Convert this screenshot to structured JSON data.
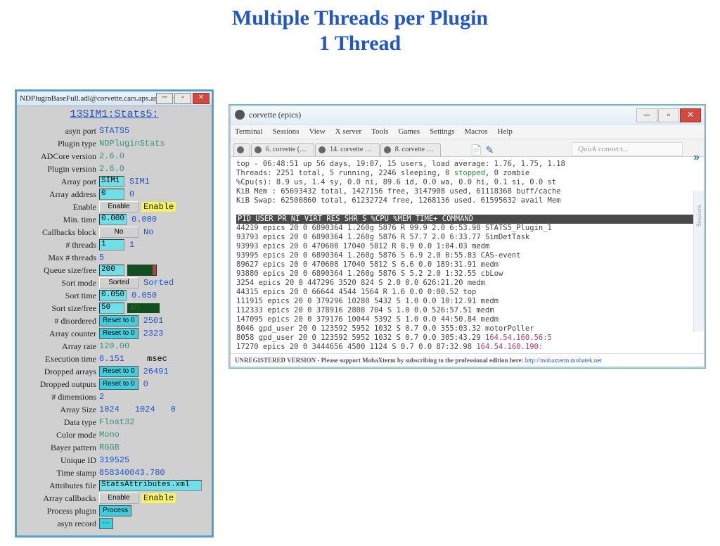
{
  "heading": "Multiple Threads per Plugin\n1 Thread",
  "medm": {
    "title": "NDPluginBaseFull.adl@corvette.cars.aps.anl.gov",
    "head": "13SIM1:Stats5:",
    "rows": [
      {
        "k": "asyn port",
        "v": "STATS5",
        "c": "blue"
      },
      {
        "k": "Plugin type",
        "v": "NDPluginStats",
        "c": "teal"
      },
      {
        "k": "ADCore version",
        "v": "2.6.0",
        "c": "teal"
      },
      {
        "k": "Plugin version",
        "v": "2.6.0",
        "c": "teal"
      },
      {
        "k": "Array port",
        "v": "SIM1",
        "ctl": "cyanfield",
        "suf": "SIM1",
        "sc": "blue"
      },
      {
        "k": "Array address",
        "v": "0",
        "ctl": "cyanfield",
        "suf": "0",
        "sc": "blue"
      },
      {
        "k": "Enable",
        "v": "Enable",
        "ctl": "drop",
        "suf": "Enable",
        "yellow": true
      },
      {
        "k": "Min. time",
        "v": "0.000",
        "ctl": "cyanfield",
        "suf": "0.000",
        "sc": "blue"
      },
      {
        "k": "Callbacks block",
        "v": "No",
        "ctl": "drop",
        "suf": "No",
        "sc": "blue"
      },
      {
        "k": "# threads",
        "v": "1",
        "ctl": "cyanfield",
        "suf": "1",
        "sc": "blue"
      },
      {
        "k": "Max # threads",
        "v": "5",
        "c": "blue"
      },
      {
        "k": "Queue size/free",
        "v": "200",
        "ctl": "cyanfield",
        "bar": true
      },
      {
        "k": "Sort mode",
        "v": "Sorted",
        "ctl": "drop",
        "suf": "Sorted",
        "sc": "blue"
      },
      {
        "k": "Sort time",
        "v": "0.050",
        "ctl": "cyanfield",
        "suf": "0.050",
        "sc": "blue"
      },
      {
        "k": "Sort size/free",
        "v": "50",
        "ctl": "cyanfield",
        "suf": "48",
        "sc": "grn",
        "dark": true
      },
      {
        "k": "# disordered",
        "v": "Reset to 0",
        "ctl": "cyanbtn",
        "suf": "2501",
        "sc": "blue"
      },
      {
        "k": "Array counter",
        "v": "Reset to 0",
        "ctl": "cyanbtn",
        "suf": "2323",
        "sc": "blue"
      },
      {
        "k": "Array rate",
        "v": "120.00",
        "c": "teal"
      },
      {
        "k": "Execution time",
        "v": "8.151",
        "c": "blue",
        "suf": "msec",
        "sc": ""
      },
      {
        "k": "Dropped arrays",
        "v": "Reset to 0",
        "ctl": "cyanbtn",
        "suf": "26491",
        "sc": "blue"
      },
      {
        "k": "Dropped outputs",
        "v": "Reset to 0",
        "ctl": "cyanbtn",
        "suf": "0",
        "sc": "blue"
      },
      {
        "k": "# dimensions",
        "v": "2",
        "c": "blue"
      },
      {
        "k": "Array Size",
        "v": "1024",
        "c": "blue",
        "extra": [
          "1024",
          "0"
        ]
      },
      {
        "k": "Data type",
        "v": "Float32",
        "c": "teal"
      },
      {
        "k": "Color mode",
        "v": "Mono",
        "c": "teal"
      },
      {
        "k": "Bayer pattern",
        "v": "RGGB",
        "c": "teal"
      },
      {
        "k": "Unique ID",
        "v": "319525",
        "c": "blue"
      },
      {
        "k": "Time stamp",
        "v": "858340043.780",
        "c": "blue"
      },
      {
        "k": "Attributes file",
        "v": "StatsAttributes.xml",
        "ctl": "cyanfield",
        "wide": true
      },
      {
        "k": "Array callbacks",
        "v": "Enable",
        "ctl": "drop",
        "suf": "Enable",
        "yellow": true
      },
      {
        "k": "Process plugin",
        "v": "Process",
        "ctl": "cyanbtn"
      },
      {
        "k": "asyn record",
        "v": " ⋯ ",
        "ctl": "cyanbtn"
      }
    ]
  },
  "moba": {
    "title": "corvette (epics)",
    "menu": [
      "Terminal",
      "Sessions",
      "View",
      "X server",
      "Tools",
      "Games",
      "Settings",
      "Macros",
      "Help"
    ],
    "tabs": [
      " 6. corvette (…",
      " 14. corvette …",
      " 8. corvette …"
    ],
    "quick": "Quick connect...",
    "top": [
      "top - 06:48:51 up 56 days, 19:07, 15 users,  load average: 1.76, 1.75, 1.18",
      "Threads: 2251 total,   5 running, 2246 sleeping,   0 stopped,   0 zombie",
      "%Cpu(s):  8.9 us,  1.4 sy,  0.0 ni, 89.6 id,  0.0 wa,  0.0 hi,  0.1 si,  0.0 st",
      "KiB Mem : 65693432 total,  1427156 free,  3147908 used, 61118368 buff/cache",
      "KiB Swap: 62500860 total, 61232724 free,  1268136 used. 61595632 avail Mem"
    ],
    "hdr": "  PID USER      PR  NI    VIRT    RES    SHR S %CPU %MEM     TIME+ COMMAND",
    "proc": [
      " 44219 epics     20   0 6890364 1.260g   5876 R 99.9  2.0   6:53.98 STATS5_Plugin_1",
      " 93793 epics     20   0 6890364 1.260g   5876 R 57.7  2.0   6:33.77 SimDetTask",
      " 93993 epics     20   0  470608  17040   5812 R  8.9  0.0   1:04.03 medm",
      " 93995 epics     20   0 6890364 1.260g   5876 S  6.9  2.0   0:55.83 CAS-event",
      " 89627 epics     20   0  470608  17040   5812 S  6.6  0.0 189:31.91 medm",
      " 93880 epics     20   0 6890364 1.260g   5876 S  5.2  2.0   1:32.55 cbLow",
      "  3254 epics     20   0  447296   3520    824 S  2.0  0.0 626:21.20 medm",
      " 44315 epics     20   0   66644   4544   1564 R  1.6  0.0   0:00.52 top",
      "111915 epics     20   0  379296  10280   5432 S  1.0  0.0  10:12.91 medm",
      "112333 epics     20   0  378916   2808    704 S  1.0  0.0 526:57.51 medm",
      "147095 epics     20   0  379176  10044   5392 S  1.0  0.0  44:50.84 medm",
      "  8046 gpd_user  20   0  123592   5952   1032 S  0.7  0.0 355:03.32 motorPoller",
      "  8058 gpd_user  20   0  123592   5952   1032 S  0.7  0.0 305:43.29 164.54.160.56:5",
      " 17270 epics     20   0 3444656   4500   1124 S  0.7  0.0  87:32.98 164.54.160.190:"
    ],
    "foot_pre": "UNREGISTERED VERSION - Please support MobaXterm by subscribing to the professional edition here:",
    "foot_link": "http://mobaxterm.mobatek.net",
    "side": "Sessions"
  }
}
